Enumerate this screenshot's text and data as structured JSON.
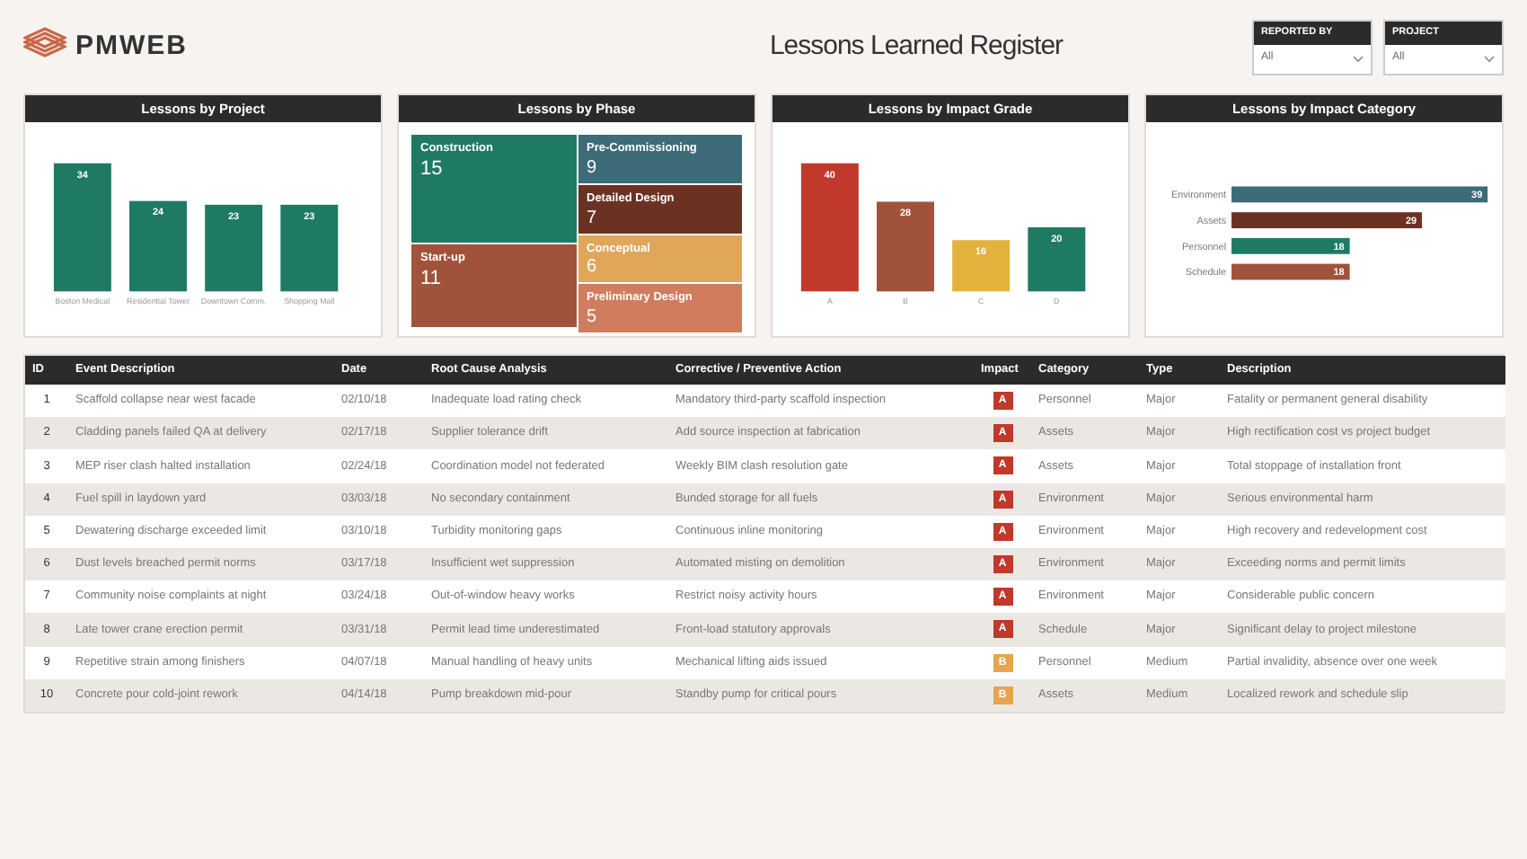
{
  "brand": "PMWEB",
  "title": "Lessons Learned Register",
  "filters": [
    {
      "label": "REPORTED BY",
      "value": "All"
    },
    {
      "label": "PROJECT",
      "value": "All"
    }
  ],
  "charts": [
    {
      "title": "Lessons by Project",
      "chart_data": {
        "type": "bar",
        "categories": [
          "Boston Medical",
          "Residential Tower",
          "Downtown Comm.",
          "Shopping Mall"
        ],
        "series": [
          {
            "color": "#1f7a64",
            "values": [
              34,
              24,
              23,
              23
            ]
          }
        ],
        "data_labels": true
      }
    },
    {
      "title": "Lessons by Phase",
      "tiles": [
        {
          "label": "Construction",
          "value": "15",
          "color": "#1f7a64"
        },
        {
          "label": "Start-up",
          "value": "11",
          "color": "#a0533a"
        },
        {
          "label": "Pre-Commissioning",
          "value": "9",
          "color": "#3d6b78"
        },
        {
          "label": "Detailed Design",
          "value": "7",
          "color": "#6b3224"
        },
        {
          "label": "Conceptual",
          "value": "6",
          "color": "#e0a65a"
        },
        {
          "label": "Preliminary Design",
          "value": "5",
          "color": "#d07c5e"
        }
      ]
    },
    {
      "title": "Lessons by Impact Grade",
      "chart_data": {
        "type": "bar",
        "stacked": true,
        "categories": [
          "A",
          "B",
          "C",
          "D"
        ],
        "series": [
          {
            "color": "#c0392b",
            "values": [
              40,
              null,
              null,
              null
            ]
          },
          {
            "color": "#a0533a",
            "values": [
              null,
              28,
              null,
              null
            ]
          },
          {
            "color": "#e3b23c",
            "values": [
              null,
              null,
              16,
              null
            ]
          },
          {
            "color": "#1f7a64",
            "values": [
              null,
              null,
              null,
              20
            ]
          }
        ],
        "data_labels": true
      }
    },
    {
      "title": "Lessons by Impact Category",
      "chart_data": {
        "type": "bar",
        "orientation": "horizontal",
        "stacked": true,
        "categories": [
          "Environment",
          "Assets",
          "Personnel",
          "Schedule"
        ],
        "series": [
          {
            "color": "#3d6b78",
            "values": [
              39,
              null,
              null,
              null
            ]
          },
          {
            "color": "#6b3224",
            "values": [
              null,
              29,
              null,
              null
            ]
          },
          {
            "color": "#1f7a64",
            "values": [
              null,
              null,
              18,
              null
            ]
          },
          {
            "color": "#a0533a",
            "values": [
              null,
              null,
              null,
              18
            ]
          }
        ],
        "data_labels": true
      }
    }
  ],
  "table": {
    "columns": [
      "ID",
      "Event Description",
      "Date",
      "Root Cause Analysis",
      "Corrective / Preventive Action",
      "Impact",
      "Category",
      "Type",
      "Description"
    ],
    "rows": [
      {
        "cells": [
          "1",
          "Scaffold collapse near west facade",
          "02/10/18",
          "Inadequate load rating check",
          "Mandatory third-party scaffold inspection"
        ],
        "impact": {
          "grade": "A",
          "color": "#c0392b"
        },
        "rest": [
          "Personnel",
          "Major",
          "Fatality or permanent general disability"
        ]
      },
      {
        "cells": [
          "2",
          "Cladding panels failed QA at delivery",
          "02/17/18",
          "Supplier tolerance drift",
          "Add source inspection at fabrication"
        ],
        "impact": {
          "grade": "A",
          "color": "#c0392b"
        },
        "rest": [
          "Assets",
          "Major",
          "High rectification cost vs project budget"
        ]
      },
      {
        "cells": [
          "3",
          "MEP riser clash halted installation",
          "02/24/18",
          "Coordination model not federated",
          "Weekly BIM clash resolution gate"
        ],
        "impact": {
          "grade": "A",
          "color": "#c0392b"
        },
        "rest": [
          "Assets",
          "Major",
          "Total stoppage of installation front"
        ]
      },
      {
        "cells": [
          "4",
          "Fuel spill in laydown yard",
          "03/03/18",
          "No secondary containment",
          "Bunded storage for all fuels"
        ],
        "impact": {
          "grade": "A",
          "color": "#c0392b"
        },
        "rest": [
          "Environment",
          "Major",
          "Serious environmental harm"
        ]
      },
      {
        "cells": [
          "5",
          "Dewatering discharge exceeded limit",
          "03/10/18",
          "Turbidity monitoring gaps",
          "Continuous inline monitoring"
        ],
        "impact": {
          "grade": "A",
          "color": "#c0392b"
        },
        "rest": [
          "Environment",
          "Major",
          "High recovery and redevelopment cost"
        ]
      },
      {
        "cells": [
          "6",
          "Dust levels breached permit norms",
          "03/17/18",
          "Insufficient wet suppression",
          "Automated misting on demolition"
        ],
        "impact": {
          "grade": "A",
          "color": "#c0392b"
        },
        "rest": [
          "Environment",
          "Major",
          "Exceeding norms and permit limits"
        ]
      },
      {
        "cells": [
          "7",
          "Community noise complaints at night",
          "03/24/18",
          "Out-of-window heavy works",
          "Restrict noisy activity hours"
        ],
        "impact": {
          "grade": "A",
          "color": "#c0392b"
        },
        "rest": [
          "Environment",
          "Major",
          "Considerable public concern"
        ]
      },
      {
        "cells": [
          "8",
          "Late tower crane erection permit",
          "03/31/18",
          "Permit lead time underestimated",
          "Front-load statutory approvals"
        ],
        "impact": {
          "grade": "A",
          "color": "#c0392b"
        },
        "rest": [
          "Schedule",
          "Major",
          "Significant delay to project milestone"
        ]
      },
      {
        "cells": [
          "9",
          "Repetitive strain among finishers",
          "04/07/18",
          "Manual handling of heavy units",
          "Mechanical lifting aids issued"
        ],
        "impact": {
          "grade": "B",
          "color": "#e5a550"
        },
        "rest": [
          "Personnel",
          "Medium",
          "Partial invalidity, absence over one week"
        ]
      },
      {
        "cells": [
          "10",
          "Concrete pour cold-joint rework",
          "04/14/18",
          "Pump breakdown mid-pour",
          "Standby pump for critical pours"
        ],
        "impact": {
          "grade": "B",
          "color": "#e5a550"
        },
        "rest": [
          "Assets",
          "Medium",
          "Localized rework and schedule slip"
        ]
      }
    ]
  }
}
